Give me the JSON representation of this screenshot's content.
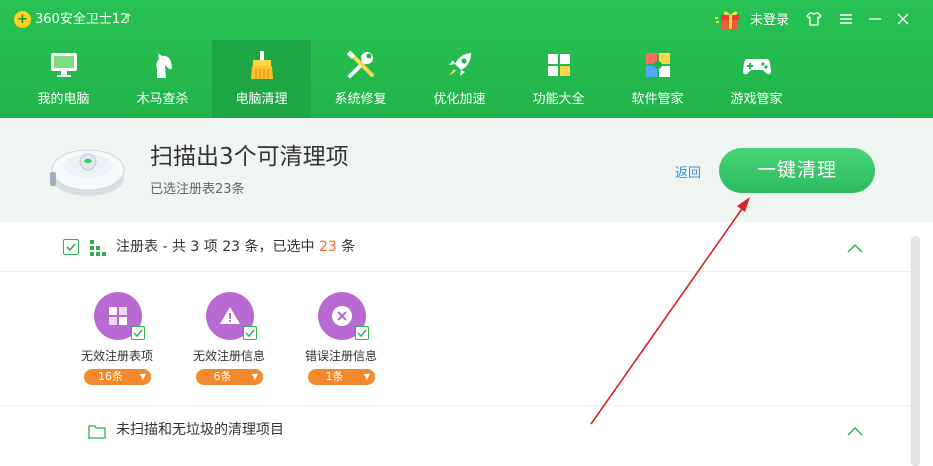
{
  "app": {
    "title": "360安全卫士12",
    "update_arrow": "↑",
    "login": "未登录"
  },
  "window_controls": [
    "skin-icon",
    "menu-icon",
    "minimize-icon",
    "close-icon"
  ],
  "nav": [
    {
      "label": "我的电脑",
      "icon": "computer-icon"
    },
    {
      "label": "木马查杀",
      "icon": "trojan-horse-icon"
    },
    {
      "label": "电脑清理",
      "icon": "cleanup-brush-icon",
      "active": true
    },
    {
      "label": "系统修复",
      "icon": "repair-tools-icon"
    },
    {
      "label": "优化加速",
      "icon": "rocket-icon"
    },
    {
      "label": "功能大全",
      "icon": "grid-apps-icon"
    },
    {
      "label": "软件管家",
      "icon": "software-manager-icon"
    },
    {
      "label": "游戏管家",
      "icon": "gamepad-icon"
    }
  ],
  "summary": {
    "headline": "扫描出3个可清理项",
    "subline": "已选注册表23条",
    "back": "返回",
    "clean_button": "一键清理"
  },
  "registry_section": {
    "title_prefix": "注册表 - 共 3 项 23 条，已选中 ",
    "selected_count": "23",
    "title_suffix": " 条",
    "items": [
      {
        "label": "无效注册表项",
        "count": "16条",
        "icon": "registry-grid-icon"
      },
      {
        "label": "无效注册信息",
        "count": "6条",
        "icon": "warning-icon"
      },
      {
        "label": "错误注册信息",
        "count": "1条",
        "icon": "error-x-icon"
      }
    ]
  },
  "unscanned_section": {
    "title": "未扫描和无垃圾的清理项目"
  },
  "colors": {
    "brand_green": "#21b44a",
    "accent_orange": "#f0672e",
    "item_purple": "#b86ad2",
    "badge_orange": "#f28a2b",
    "annotation_red": "#d8232a"
  }
}
